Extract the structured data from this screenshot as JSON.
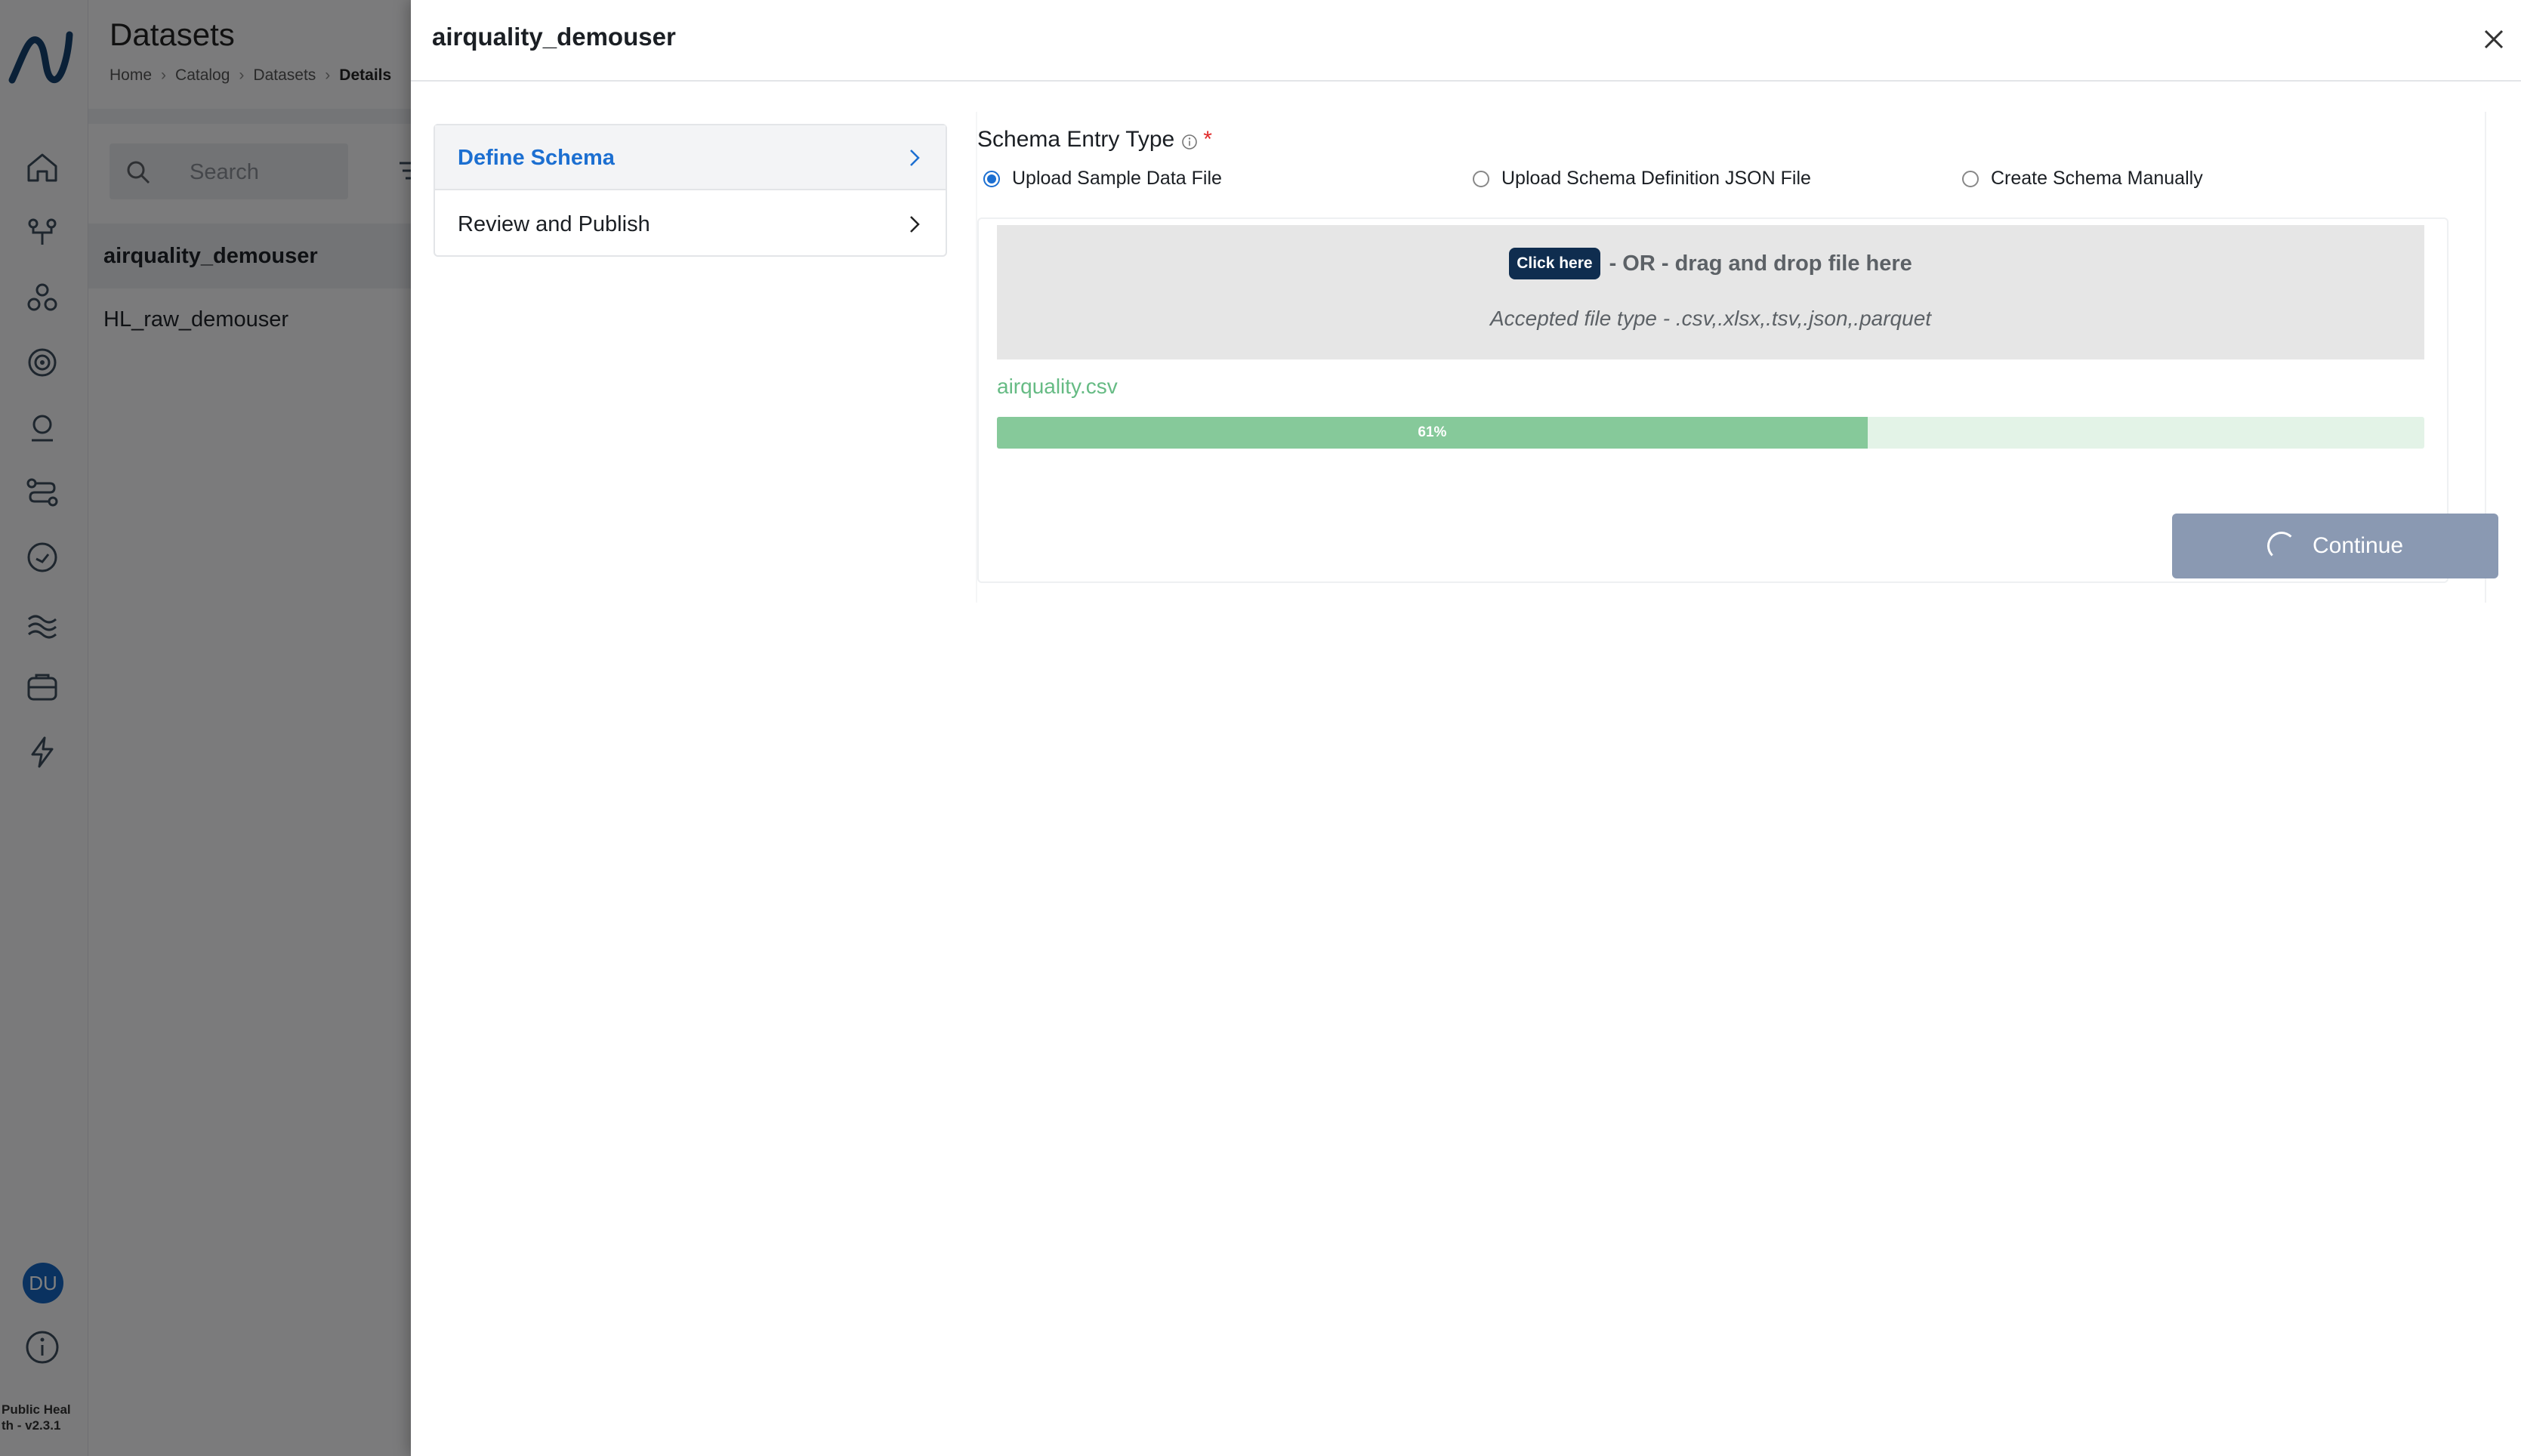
{
  "page": {
    "title": "Datasets",
    "breadcrumb": [
      "Home",
      "Catalog",
      "Datasets",
      "Details"
    ],
    "search_placeholder": "Search",
    "datasets": [
      "airquality_demouser",
      "HL_raw_demouser"
    ]
  },
  "rail": {
    "avatar_initials": "DU",
    "version_line1": "Public Heal",
    "version_line2": "th - v2.3.1"
  },
  "drawer": {
    "title": "airquality_demouser",
    "steps": [
      {
        "label": "Define Schema",
        "active": true
      },
      {
        "label": "Review and Publish",
        "active": false
      }
    ],
    "schema_entry_label": "Schema Entry Type",
    "required_mark": "*",
    "options": [
      {
        "label": "Upload Sample Data File",
        "selected": true
      },
      {
        "label": "Upload Schema Definition JSON File",
        "selected": false
      },
      {
        "label": "Create Schema Manually",
        "selected": false
      }
    ],
    "upload": {
      "button_label": "Click here",
      "or_text": "- OR - drag and drop file here",
      "accepted_text": "Accepted file type - .csv,.xlsx,.tsv,.json,.parquet",
      "file_name": "airquality.csv",
      "progress": 61,
      "progress_label": "61%"
    },
    "continue_label": "Continue"
  },
  "colors": {
    "accent": "#1c6fd1",
    "progress_fill": "#86c99a",
    "progress_track": "#e3f3e7",
    "button_disabled": "#8a99b2",
    "click_here_bg": "#0f2d4f"
  }
}
